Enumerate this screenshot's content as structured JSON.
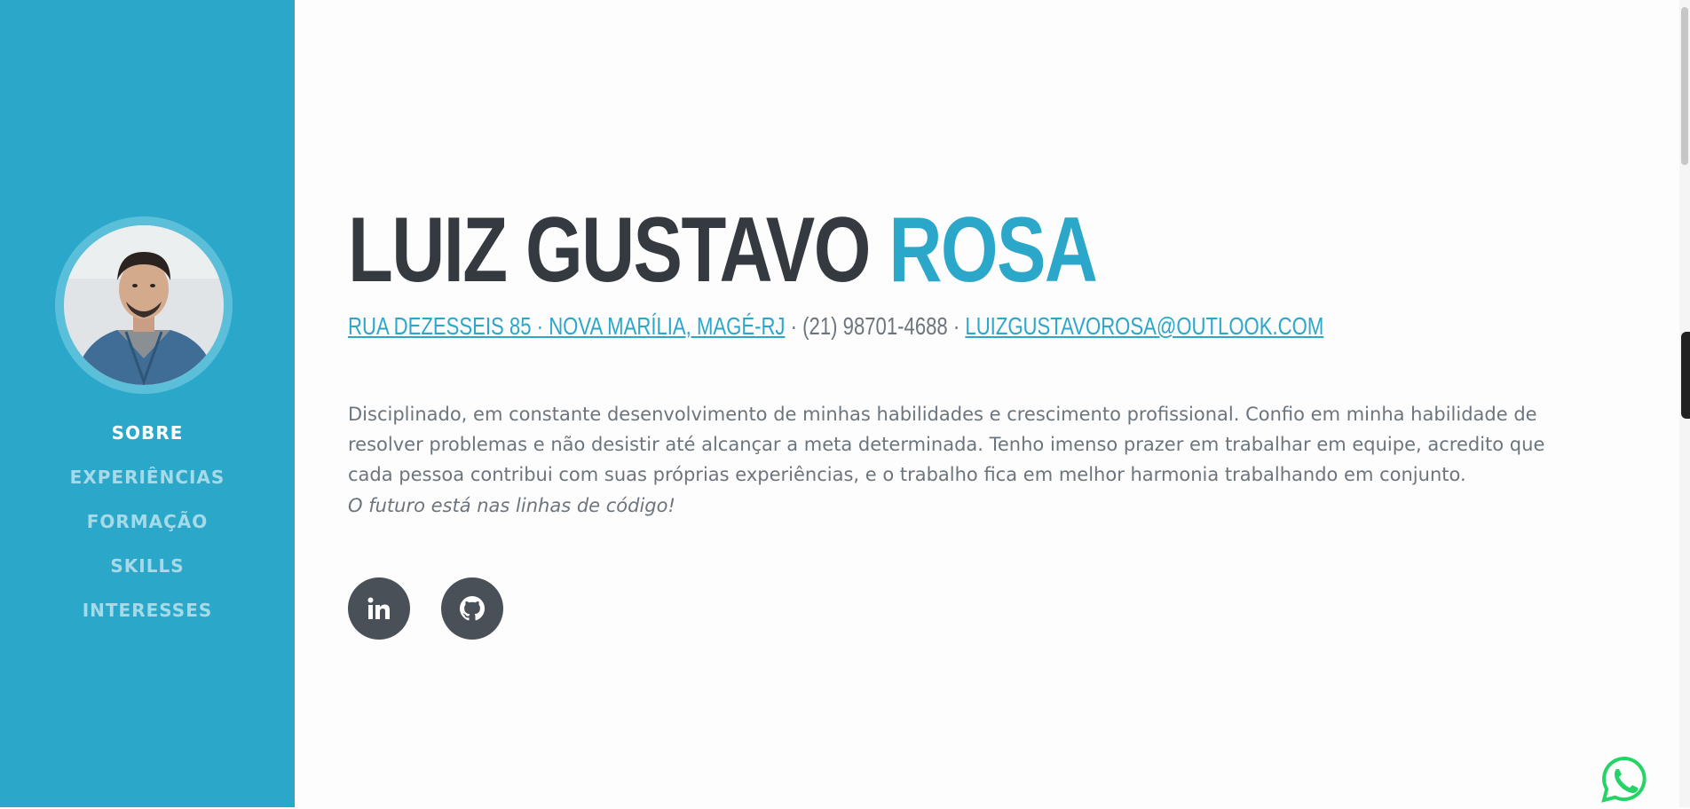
{
  "sidebar": {
    "avatar_alt": "profile photo",
    "nav": [
      {
        "label": "SOBRE",
        "active": true
      },
      {
        "label": "EXPERIÊNCIAS",
        "active": false
      },
      {
        "label": "FORMAÇÃO",
        "active": false
      },
      {
        "label": "SKILLS",
        "active": false
      },
      {
        "label": "INTERESSES",
        "active": false
      }
    ]
  },
  "header": {
    "first_names": "LUIZ GUSTAVO",
    "last_name": "ROSA"
  },
  "contact": {
    "address": "RUA DEZESSEIS 85 · NOVA MARÍLIA, MAGÉ-RJ",
    "separator": " · ",
    "phone": "(21) 98701-4688",
    "email": "LUIZGUSTAVOROSA@OUTLOOK.COM"
  },
  "bio": "Disciplinado, em constante desenvolvimento de minhas habilidades e crescimento profissional. Confio em minha habilidade de resolver problemas e não desistir até alcançar a meta determinada. Tenho imenso prazer em trabalhar em equipe, acredito que cada pessoa contribui com suas próprias experiências, e o trabalho fica em melhor harmonia trabalhando em conjunto.",
  "motto": "O futuro está nas linhas de código!",
  "social": {
    "linkedin": "linkedin-icon",
    "github": "github-icon"
  },
  "colors": {
    "primary": "#2ba7c9",
    "dark": "#343a40",
    "muted": "#6c757d",
    "whatsapp": "#25d366"
  }
}
